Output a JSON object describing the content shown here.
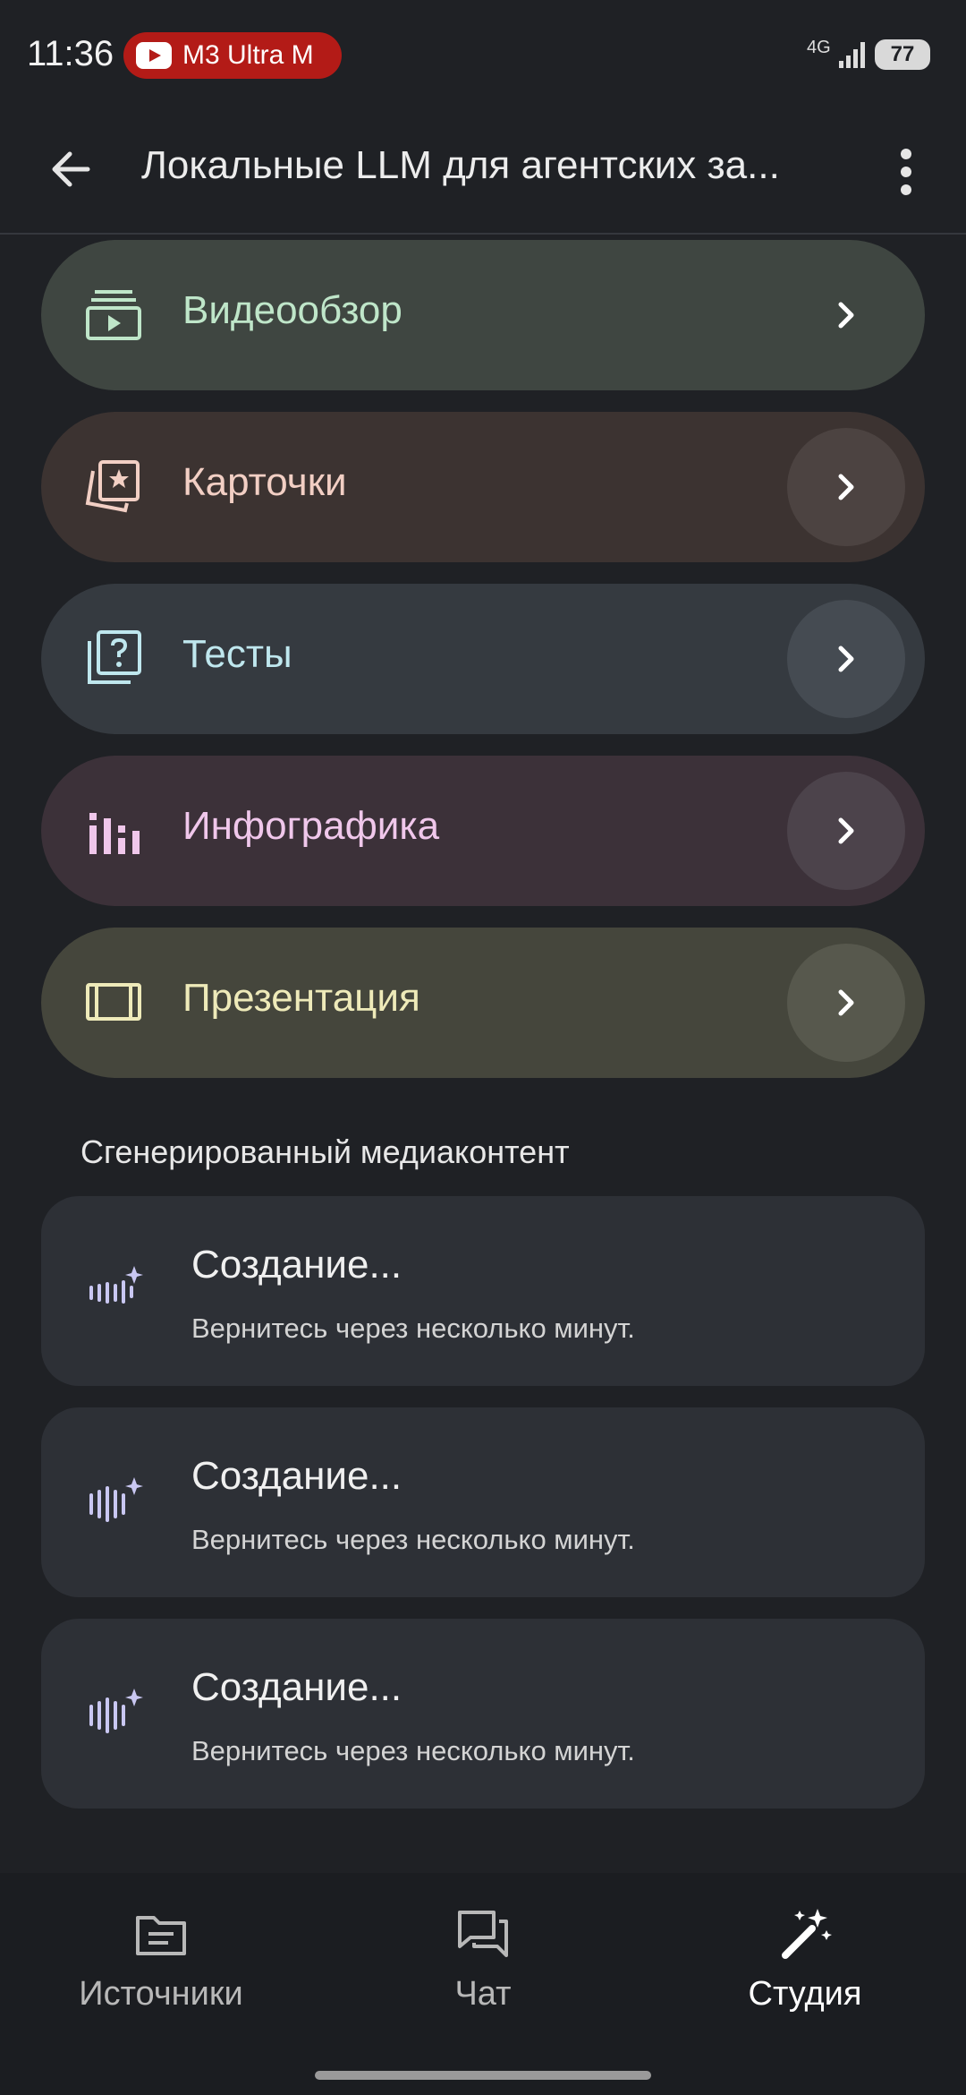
{
  "status": {
    "time": "11:36",
    "media_text": "M3 Ultra M",
    "network": "4G",
    "battery": "77"
  },
  "app_bar": {
    "title": "Локальные LLM для агентских за..."
  },
  "cards": [
    {
      "label": "Видеообзор",
      "icon": "video-overview-icon",
      "color": "#bfe6c9"
    },
    {
      "label": "Карточки",
      "icon": "flashcards-icon",
      "color": "#f2cfc4"
    },
    {
      "label": "Тесты",
      "icon": "quiz-icon",
      "color": "#bfe7ee"
    },
    {
      "label": "Инфографика",
      "icon": "infographic-icon",
      "color": "#f0c7eb"
    },
    {
      "label": "Презентация",
      "icon": "presentation-icon",
      "color": "#eeeab9"
    }
  ],
  "section": {
    "title": "Сгенерированный медиаконтент"
  },
  "media": [
    {
      "title": "Создание...",
      "subtitle": "Вернитесь через несколько минут."
    },
    {
      "title": "Создание...",
      "subtitle": "Вернитесь через несколько минут."
    },
    {
      "title": "Создание...",
      "subtitle": "Вернитесь через несколько минут."
    }
  ],
  "nav": {
    "sources": "Источники",
    "chat": "Чат",
    "studio": "Студия",
    "active": "studio"
  }
}
